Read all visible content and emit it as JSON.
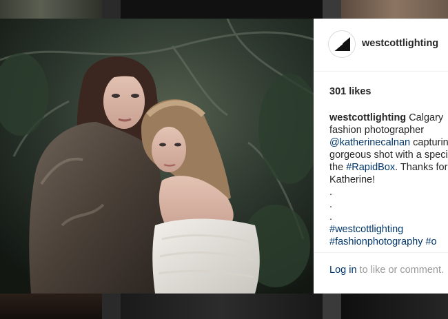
{
  "post": {
    "username": "westcottlighting",
    "likes": "301 likes",
    "caption": {
      "author": "westcottlighting",
      "line1_text": " Calgary",
      "line2": "fashion photographer",
      "mention": "@katherinecalnan",
      "line3_text": " capturing",
      "line4": "gorgeous shot with a special",
      "line5_pre": "the ",
      "hashtag_rapidbox": "#RapidBox",
      "line5_post": ". Thanks for",
      "line6": "Katherine!",
      "dot1": ".",
      "dot2": ".",
      "dot3": ".",
      "hashtag1": "#westcottlighting",
      "hashtag2": "#fashionphotography",
      "hashtag3": "#o"
    },
    "footer": {
      "login_label": "Log in",
      "login_suffix": " to like or comment."
    }
  },
  "icons": {
    "avatar": "westcott-logo-icon"
  },
  "colors": {
    "link": "#003569",
    "text": "#262626",
    "muted": "#999999",
    "backdrop": "#161616"
  }
}
